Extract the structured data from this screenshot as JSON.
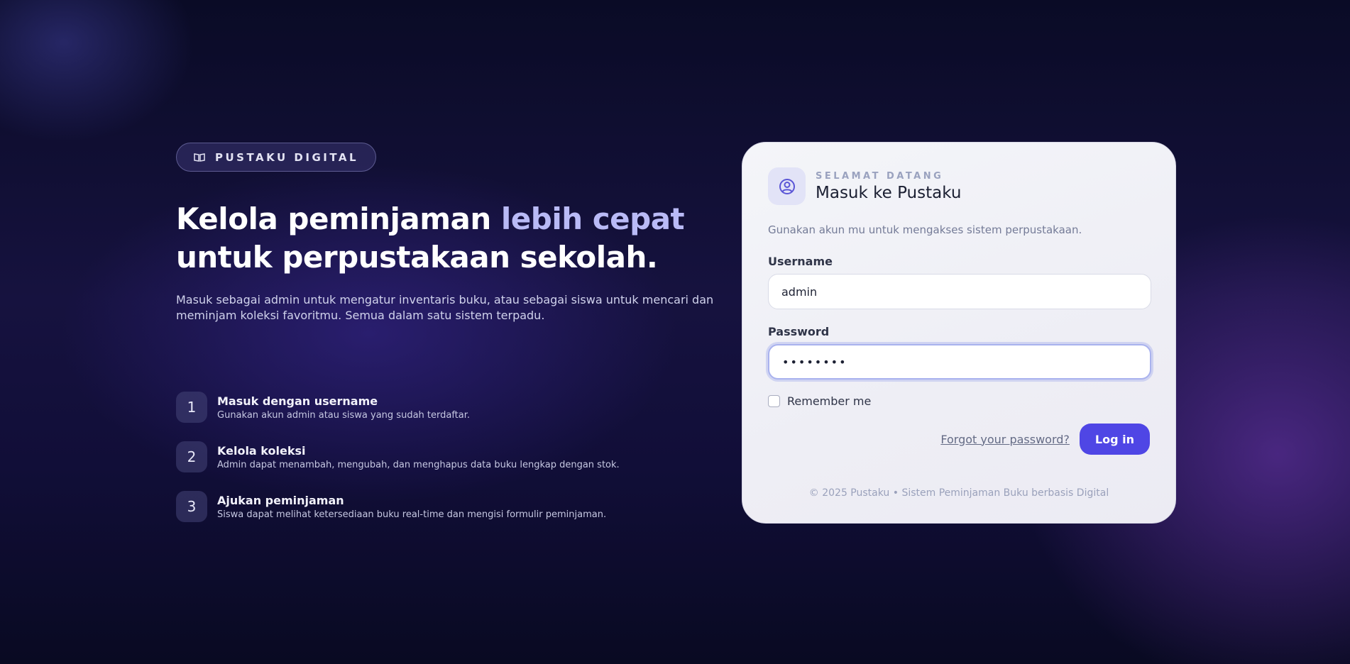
{
  "brand": {
    "label": "PUSTAKU DIGITAL",
    "icon": "book-icon"
  },
  "hero": {
    "headline_before": "Kelola peminjaman ",
    "headline_accent": "lebih cepat",
    "headline_after": " untuk perpustakaan sekolah.",
    "subtext": "Masuk sebagai admin untuk mengatur inventaris buku, atau sebagai siswa untuk mencari dan meminjam koleksi favoritmu. Semua dalam satu sistem terpadu."
  },
  "steps": [
    {
      "num": "1",
      "title": "Masuk dengan username",
      "desc": "Gunakan akun admin atau siswa yang sudah terdaftar."
    },
    {
      "num": "2",
      "title": "Kelola koleksi",
      "desc": "Admin dapat menambah, mengubah, dan menghapus data buku lengkap dengan stok."
    },
    {
      "num": "3",
      "title": "Ajukan peminjaman",
      "desc": "Siswa dapat melihat ketersediaan buku real-time dan mengisi formulir peminjaman."
    }
  ],
  "card": {
    "eyebrow": "SELAMAT DATANG",
    "title": "Masuk ke Pustaku",
    "description": "Gunakan akun mu untuk mengakses sistem perpustakaan.",
    "username_label": "Username",
    "username_value": "admin",
    "password_label": "Password",
    "password_value": "••••••••",
    "remember_label": "Remember me",
    "forgot_label": "Forgot your password?",
    "login_label": "Log in",
    "footer": "© 2025 Pustaku • Sistem Peminjaman Buku berbasis Digital"
  },
  "colors": {
    "accent": "#4f46e5",
    "headline_accent": "#b9baf6"
  }
}
